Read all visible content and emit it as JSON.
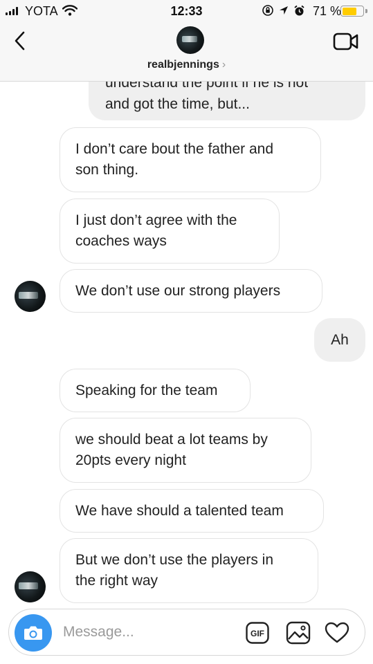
{
  "status_bar": {
    "carrier": "YOTA",
    "time": "12:33",
    "battery_percent": "71 %",
    "battery_level": 0.71,
    "icons": [
      "signal-icon",
      "wifi-icon",
      "orientation-lock-icon",
      "location-icon",
      "alarm-icon",
      "battery-icon"
    ]
  },
  "header": {
    "username": "realbjennings",
    "chevron": "›",
    "icons": [
      "back-chevron-icon",
      "profile-avatar",
      "video-call-icon"
    ]
  },
  "messages": {
    "partial_outgoing": {
      "line1": "understand the point if he is not",
      "line2": "and got the time, but..."
    },
    "items": [
      {
        "from": "them",
        "text": "I don’t care bout the father and\nson thing."
      },
      {
        "from": "them",
        "text": "I just don’t agree with the\ncoaches ways"
      },
      {
        "from": "them",
        "text": "We don’t use our strong players"
      },
      {
        "from": "me",
        "text": "Ah"
      },
      {
        "from": "them",
        "text": "Speaking for the team"
      },
      {
        "from": "them",
        "text": "we should beat a lot teams by\n20pts every night"
      },
      {
        "from": "them",
        "text": "We have should a talented team"
      },
      {
        "from": "them",
        "text": "But we don’t use the players in\nthe right way"
      }
    ]
  },
  "composer": {
    "placeholder": "Message...",
    "gif_label": "GIF",
    "icons": [
      "camera-icon",
      "gif-icon",
      "gallery-icon",
      "heart-icon"
    ]
  },
  "colors": {
    "accent": "#3897f0",
    "outgoing_bubble": "#efefef",
    "incoming_border": "#e3e3e3",
    "battery": "#ffcc00"
  }
}
